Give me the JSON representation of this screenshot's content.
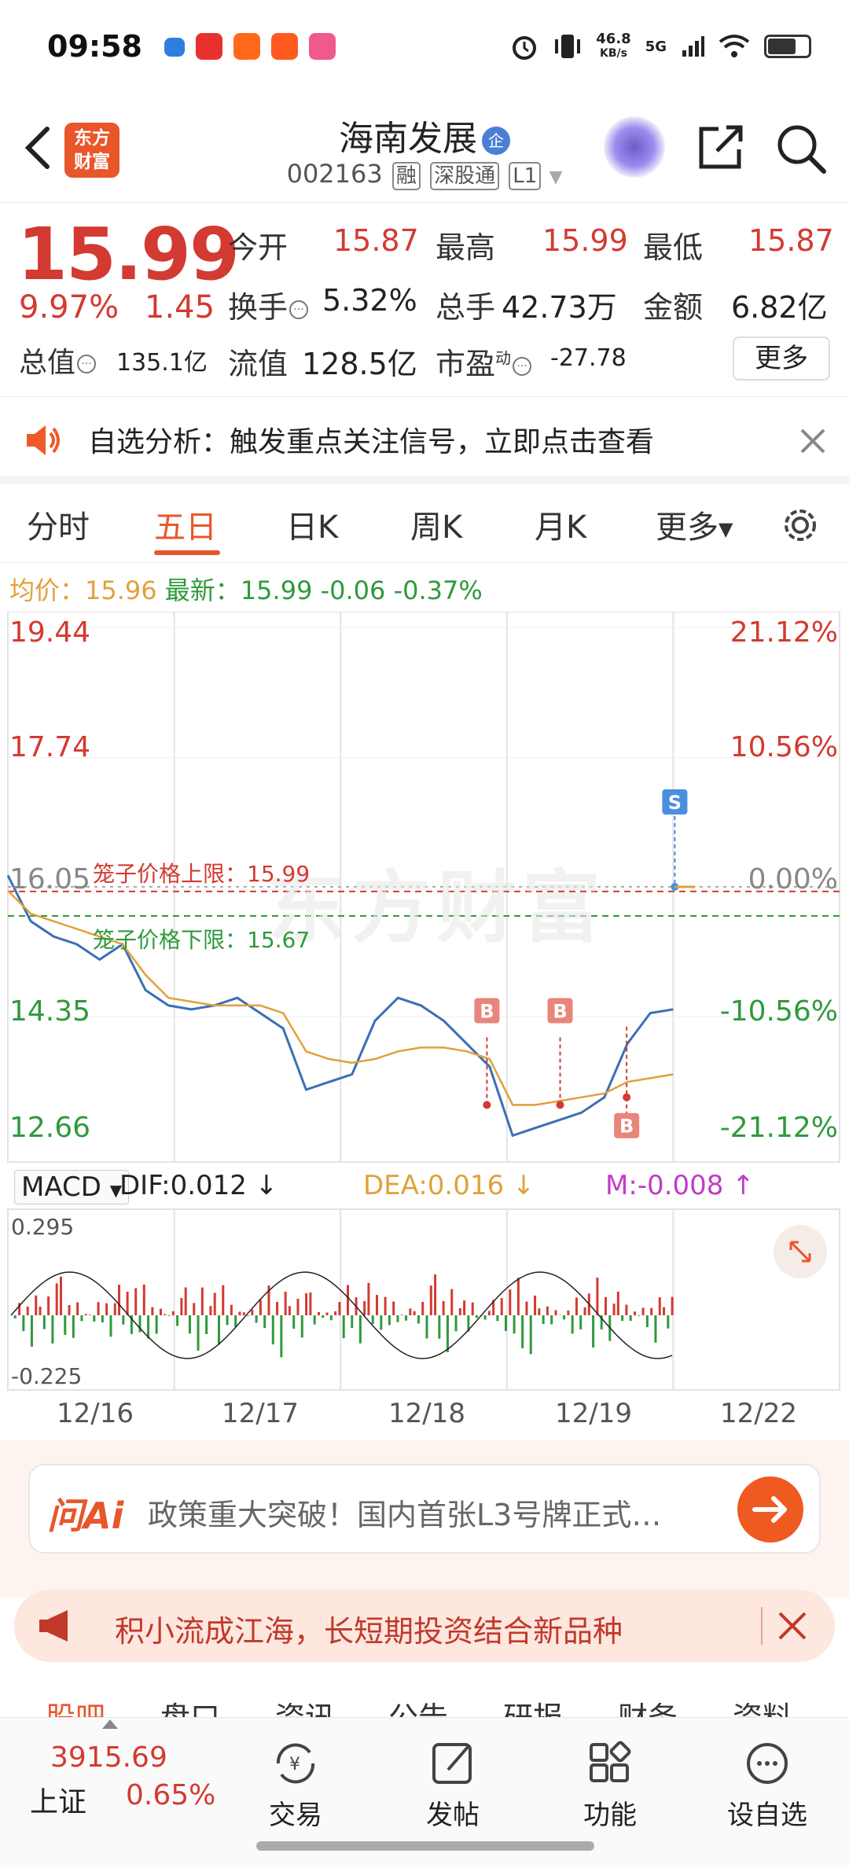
{
  "status": {
    "time": "09:58",
    "net_speed_top": "46.8",
    "net_speed_bottom": "KB/s",
    "signal": "5G"
  },
  "header": {
    "name": "海南发展",
    "badge": "企",
    "code": "002163",
    "tags": [
      "融",
      "深股通",
      "L1"
    ],
    "logo_line1": "东方",
    "logo_line2": "财富"
  },
  "quote": {
    "price": "15.99",
    "change_pct": "9.97%",
    "change_abs": "1.45",
    "open_label": "今开",
    "open": "15.87",
    "high_label": "最高",
    "high": "15.99",
    "low_label": "最低",
    "low": "15.87",
    "turnover_label": "换手",
    "turnover": "5.32%",
    "volume_label": "总手",
    "volume": "42.73万",
    "amount_label": "金额",
    "amount": "6.82亿",
    "mktcap_label": "总值",
    "mktcap": "135.1亿",
    "float_label": "流值",
    "float": "128.5亿",
    "pe_label": "市盈",
    "pe_sup": "动",
    "pe": "-27.78",
    "more": "更多"
  },
  "alert": {
    "text": "自选分析：触发重点关注信号，立即点击查看"
  },
  "tabs": [
    "分时",
    "五日",
    "日K",
    "周K",
    "月K",
    "更多"
  ],
  "active_tab": "五日",
  "avg_line": {
    "avg_label": "均价：",
    "avg": "15.96",
    "latest_label": "最新：",
    "latest": "15.99",
    "chg": "-0.06",
    "chg_pct": "-0.37%"
  },
  "chart_data": {
    "type": "line",
    "title": "",
    "x": [
      "12/16",
      "12/17",
      "12/18",
      "12/19",
      "12/22"
    ],
    "y_left_ticks": [
      "19.44",
      "17.74",
      "16.05",
      "14.35",
      "12.66"
    ],
    "y_right_ticks": [
      "21.12%",
      "10.56%",
      "0.00%",
      "-10.56%",
      "-21.12%"
    ],
    "ylim": [
      12.66,
      19.44
    ],
    "cage_upper": "笼子价格上限：15.99",
    "cage_lower": "笼子价格下限：15.67",
    "markers": [
      "B",
      "B",
      "B",
      "S"
    ],
    "watermark": "东方财富",
    "series": [
      {
        "name": "",
        "color": "#3b6fb6",
        "values": [
          16.2,
          15.6,
          15.4,
          15.3,
          15.1,
          15.3,
          14.7,
          14.5,
          14.45,
          14.5,
          14.6,
          14.4,
          14.2,
          13.4,
          13.5,
          13.6,
          14.3,
          14.6,
          14.5,
          14.3,
          14.0,
          13.7,
          12.8,
          12.9,
          13.0,
          13.1,
          13.3,
          14.0,
          14.4,
          14.45
        ]
      },
      {
        "name": "",
        "color": "#e2a13a",
        "values": [
          16.0,
          15.7,
          15.6,
          15.5,
          15.4,
          15.3,
          14.9,
          14.6,
          14.55,
          14.5,
          14.5,
          14.5,
          14.4,
          13.9,
          13.8,
          13.75,
          13.8,
          13.9,
          13.95,
          13.95,
          13.9,
          13.8,
          13.2,
          13.2,
          13.25,
          13.3,
          13.35,
          13.5,
          13.55,
          13.6
        ]
      }
    ]
  },
  "macd": {
    "name": "MACD",
    "dif": "DIF:0.012",
    "dea": "DEA:0.016",
    "m": "M:-0.008",
    "top": "0.295",
    "bottom": "-0.225"
  },
  "ai": {
    "logo": "问Ai",
    "text": "政策重大突破！国内首张L3号牌正式…"
  },
  "promo": {
    "text": "积小流成江海，长短期投资结合新品种"
  },
  "sub_tabs": [
    "股吧",
    "盘口",
    "资讯",
    "公告",
    "研报",
    "财务",
    "资料"
  ],
  "index": {
    "value": "3915.69",
    "name": "上证",
    "chg": "0.65%"
  },
  "nav": [
    "交易",
    "发帖",
    "功能",
    "设自选"
  ],
  "colors": {
    "up": "#d33a31",
    "down": "#2f9a3c",
    "accent": "#e8562a",
    "avg": "#e2a13a"
  }
}
